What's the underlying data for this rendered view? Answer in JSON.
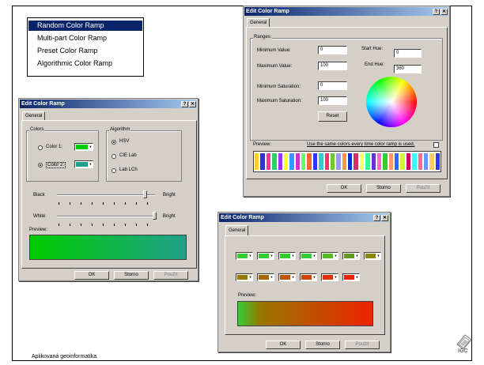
{
  "menu": {
    "items": [
      "Random Color Ramp",
      "Multi-part Color Ramp",
      "Preset Color Ramp",
      "Algorithmic Color Ramp"
    ],
    "selected_index": 0
  },
  "dialog_random": {
    "title": "Edit Color Ramp",
    "tab": "General",
    "ranges_label": "Ranges:",
    "min_value_label": "Minimum Value:",
    "min_value": "0",
    "max_value_label": "Maximum Value:",
    "max_value": "100",
    "start_hue_label": "Start Hue:",
    "start_hue": "0",
    "end_hue_label": "End Hue:",
    "end_hue": "360",
    "min_sat_label": "Minimum Saturation:",
    "min_sat": "0",
    "max_sat_label": "Maximum Saturation:",
    "max_sat": "100",
    "reset_label": "Reset",
    "preview_label": "Preview:",
    "same_colors_label": "Use the same colors every time color ramp is used.",
    "ok_label": "OK",
    "cancel_label": "Storno",
    "apply_label": "Použít",
    "preview_colors": [
      "#ffcc33",
      "#3333cc",
      "#ff3399",
      "#33cc66",
      "#9933ff",
      "#ffff33",
      "#3399ff",
      "#cc33cc",
      "#66ff66",
      "#ff6633",
      "#3333ff",
      "#33cccc",
      "#ff3366",
      "#66cc33",
      "#9999ff",
      "#ff9933",
      "#0033cc",
      "#cc3366",
      "#ffff66",
      "#33ff99",
      "#6633cc",
      "#ff66cc",
      "#33cc33",
      "#ff9966",
      "#3366ff",
      "#ccff33",
      "#cc0066",
      "#33ffff",
      "#ff6699",
      "#6699ff",
      "#ffcc66",
      "#3333ff"
    ]
  },
  "dialog_algorithmic": {
    "title": "Edit Color Ramp",
    "tab": "General",
    "colors_label": "Colors",
    "color1_label": "Color 1:",
    "color1": "#00cc00",
    "color2_label": "Color 2:",
    "color2": "#21a08c",
    "algorithm_label": "Algorithm",
    "algorithms": [
      "HSV",
      "CIE Lab",
      "Lab LCh"
    ],
    "selected_algorithm": 0,
    "black_label": "Black",
    "bright_label1": "Bright",
    "white_label": "White",
    "bright_label2": "Bright",
    "black_level": 0.9,
    "white_level": 1.0,
    "preview_label": "Preview:",
    "ok_label": "OK",
    "cancel_label": "Storno",
    "apply_label": "Použít"
  },
  "dialog_preset": {
    "title": "Edit Color Ramp",
    "tab": "General",
    "row1_colors": [
      "#33cc33",
      "#33cc33",
      "#33cc33",
      "#33cc33",
      "#55bb22",
      "#669922",
      "#888811"
    ],
    "row2_colors": [
      "#997700",
      "#aa6600",
      "#bb5500",
      "#cc4400",
      "#dd3300",
      "#ee2200"
    ],
    "preview_label": "Preview:",
    "ok_label": "OK",
    "cancel_label": "Storno",
    "apply_label": "Použít"
  },
  "footer": {
    "caption": "Aplikovaná geoinformatika",
    "logo_text": "IGC"
  }
}
